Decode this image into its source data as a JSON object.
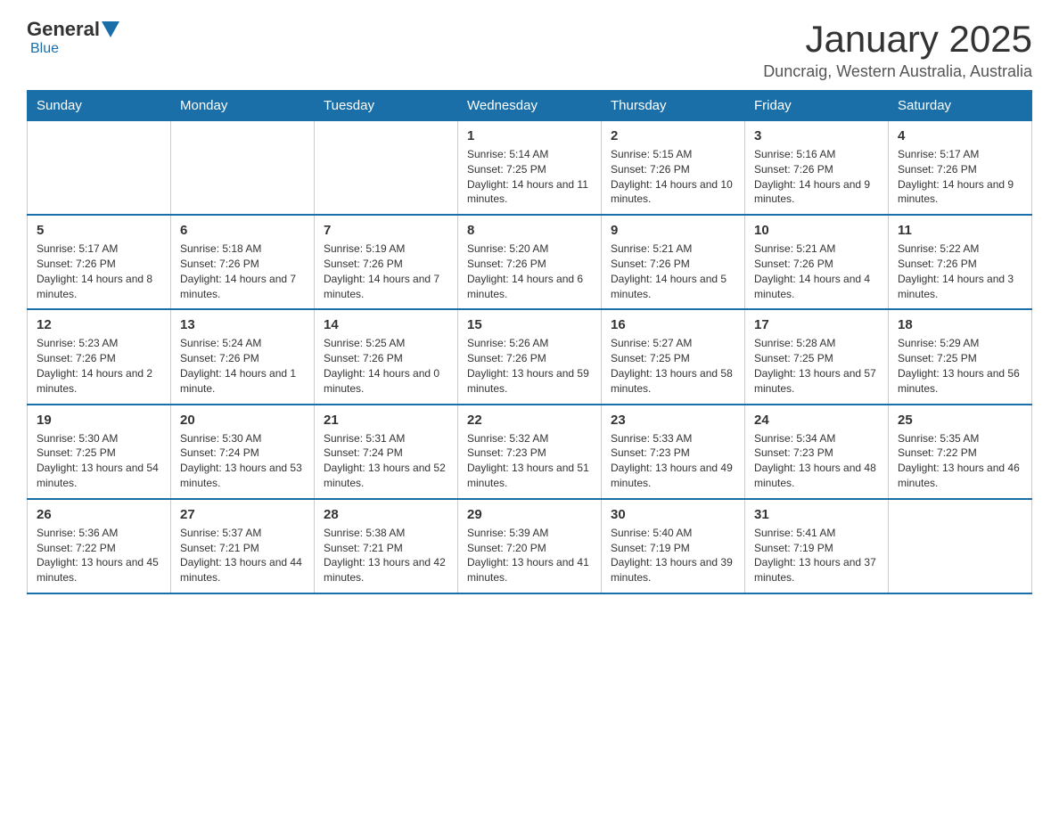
{
  "header": {
    "logo_general": "General",
    "logo_blue": "Blue",
    "month_title": "January 2025",
    "location": "Duncraig, Western Australia, Australia"
  },
  "days_of_week": [
    "Sunday",
    "Monday",
    "Tuesday",
    "Wednesday",
    "Thursday",
    "Friday",
    "Saturday"
  ],
  "weeks": [
    [
      {
        "day": "",
        "info": ""
      },
      {
        "day": "",
        "info": ""
      },
      {
        "day": "",
        "info": ""
      },
      {
        "day": "1",
        "info": "Sunrise: 5:14 AM\nSunset: 7:25 PM\nDaylight: 14 hours and 11 minutes."
      },
      {
        "day": "2",
        "info": "Sunrise: 5:15 AM\nSunset: 7:26 PM\nDaylight: 14 hours and 10 minutes."
      },
      {
        "day": "3",
        "info": "Sunrise: 5:16 AM\nSunset: 7:26 PM\nDaylight: 14 hours and 9 minutes."
      },
      {
        "day": "4",
        "info": "Sunrise: 5:17 AM\nSunset: 7:26 PM\nDaylight: 14 hours and 9 minutes."
      }
    ],
    [
      {
        "day": "5",
        "info": "Sunrise: 5:17 AM\nSunset: 7:26 PM\nDaylight: 14 hours and 8 minutes."
      },
      {
        "day": "6",
        "info": "Sunrise: 5:18 AM\nSunset: 7:26 PM\nDaylight: 14 hours and 7 minutes."
      },
      {
        "day": "7",
        "info": "Sunrise: 5:19 AM\nSunset: 7:26 PM\nDaylight: 14 hours and 7 minutes."
      },
      {
        "day": "8",
        "info": "Sunrise: 5:20 AM\nSunset: 7:26 PM\nDaylight: 14 hours and 6 minutes."
      },
      {
        "day": "9",
        "info": "Sunrise: 5:21 AM\nSunset: 7:26 PM\nDaylight: 14 hours and 5 minutes."
      },
      {
        "day": "10",
        "info": "Sunrise: 5:21 AM\nSunset: 7:26 PM\nDaylight: 14 hours and 4 minutes."
      },
      {
        "day": "11",
        "info": "Sunrise: 5:22 AM\nSunset: 7:26 PM\nDaylight: 14 hours and 3 minutes."
      }
    ],
    [
      {
        "day": "12",
        "info": "Sunrise: 5:23 AM\nSunset: 7:26 PM\nDaylight: 14 hours and 2 minutes."
      },
      {
        "day": "13",
        "info": "Sunrise: 5:24 AM\nSunset: 7:26 PM\nDaylight: 14 hours and 1 minute."
      },
      {
        "day": "14",
        "info": "Sunrise: 5:25 AM\nSunset: 7:26 PM\nDaylight: 14 hours and 0 minutes."
      },
      {
        "day": "15",
        "info": "Sunrise: 5:26 AM\nSunset: 7:26 PM\nDaylight: 13 hours and 59 minutes."
      },
      {
        "day": "16",
        "info": "Sunrise: 5:27 AM\nSunset: 7:25 PM\nDaylight: 13 hours and 58 minutes."
      },
      {
        "day": "17",
        "info": "Sunrise: 5:28 AM\nSunset: 7:25 PM\nDaylight: 13 hours and 57 minutes."
      },
      {
        "day": "18",
        "info": "Sunrise: 5:29 AM\nSunset: 7:25 PM\nDaylight: 13 hours and 56 minutes."
      }
    ],
    [
      {
        "day": "19",
        "info": "Sunrise: 5:30 AM\nSunset: 7:25 PM\nDaylight: 13 hours and 54 minutes."
      },
      {
        "day": "20",
        "info": "Sunrise: 5:30 AM\nSunset: 7:24 PM\nDaylight: 13 hours and 53 minutes."
      },
      {
        "day": "21",
        "info": "Sunrise: 5:31 AM\nSunset: 7:24 PM\nDaylight: 13 hours and 52 minutes."
      },
      {
        "day": "22",
        "info": "Sunrise: 5:32 AM\nSunset: 7:23 PM\nDaylight: 13 hours and 51 minutes."
      },
      {
        "day": "23",
        "info": "Sunrise: 5:33 AM\nSunset: 7:23 PM\nDaylight: 13 hours and 49 minutes."
      },
      {
        "day": "24",
        "info": "Sunrise: 5:34 AM\nSunset: 7:23 PM\nDaylight: 13 hours and 48 minutes."
      },
      {
        "day": "25",
        "info": "Sunrise: 5:35 AM\nSunset: 7:22 PM\nDaylight: 13 hours and 46 minutes."
      }
    ],
    [
      {
        "day": "26",
        "info": "Sunrise: 5:36 AM\nSunset: 7:22 PM\nDaylight: 13 hours and 45 minutes."
      },
      {
        "day": "27",
        "info": "Sunrise: 5:37 AM\nSunset: 7:21 PM\nDaylight: 13 hours and 44 minutes."
      },
      {
        "day": "28",
        "info": "Sunrise: 5:38 AM\nSunset: 7:21 PM\nDaylight: 13 hours and 42 minutes."
      },
      {
        "day": "29",
        "info": "Sunrise: 5:39 AM\nSunset: 7:20 PM\nDaylight: 13 hours and 41 minutes."
      },
      {
        "day": "30",
        "info": "Sunrise: 5:40 AM\nSunset: 7:19 PM\nDaylight: 13 hours and 39 minutes."
      },
      {
        "day": "31",
        "info": "Sunrise: 5:41 AM\nSunset: 7:19 PM\nDaylight: 13 hours and 37 minutes."
      },
      {
        "day": "",
        "info": ""
      }
    ]
  ]
}
